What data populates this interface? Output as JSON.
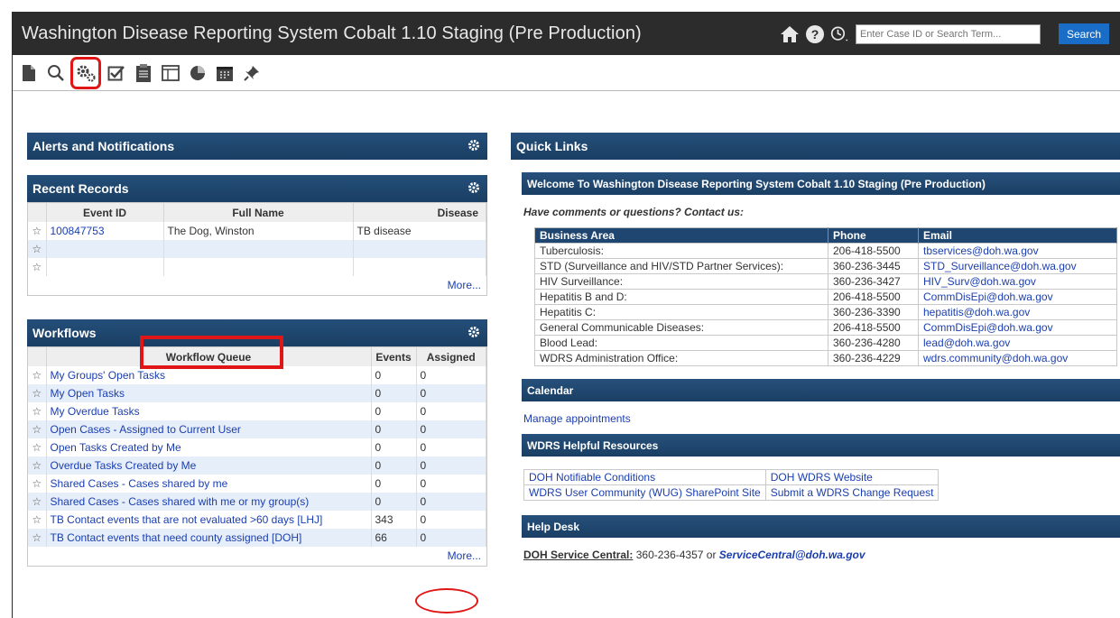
{
  "app": {
    "title": "Washington Disease Reporting System Cobalt 1.10 Staging (Pre Production)"
  },
  "topbar": {
    "search_placeholder": "Enter Case ID or Search Term...",
    "search_button": "Search"
  },
  "alerts": {
    "title": "Alerts and Notifications"
  },
  "recent": {
    "title": "Recent Records",
    "columns": [
      "Event ID",
      "Full Name",
      "Disease"
    ],
    "rows": [
      {
        "id": "100847753",
        "name": "The Dog, Winston",
        "disease": "TB disease"
      }
    ],
    "more": "More..."
  },
  "workflows": {
    "title": "Workflows",
    "columns": [
      "Workflow Queue",
      "Events",
      "Assigned"
    ],
    "rows": [
      {
        "name": "My Groups' Open Tasks",
        "events": "0",
        "assigned": "0"
      },
      {
        "name": "My Open Tasks",
        "events": "0",
        "assigned": "0"
      },
      {
        "name": "My Overdue Tasks",
        "events": "0",
        "assigned": "0"
      },
      {
        "name": "Open Cases - Assigned to Current User",
        "events": "0",
        "assigned": "0"
      },
      {
        "name": "Open Tasks Created by Me",
        "events": "0",
        "assigned": "0"
      },
      {
        "name": "Overdue Tasks Created by Me",
        "events": "0",
        "assigned": "0"
      },
      {
        "name": "Shared Cases - Cases shared by me",
        "events": "0",
        "assigned": "0"
      },
      {
        "name": "Shared Cases - Cases shared with me or my group(s)",
        "events": "0",
        "assigned": "0"
      },
      {
        "name": "TB Contact events that are not evaluated >60 days [LHJ]",
        "events": "343",
        "assigned": "0"
      },
      {
        "name": "TB Contact events that need county assigned [DOH]",
        "events": "66",
        "assigned": "0"
      }
    ],
    "more": "More..."
  },
  "quicklinks": {
    "title": "Quick Links",
    "welcome": "Welcome To Washington Disease Reporting System Cobalt 1.10 Staging (Pre Production)",
    "contact_prompt": "Have comments or questions? Contact us:",
    "contact_columns": [
      "Business Area",
      "Phone",
      "Email"
    ],
    "contacts": [
      {
        "area": "Tuberculosis:",
        "phone": "206-418-5500",
        "email": "tbservices@doh.wa.gov"
      },
      {
        "area": "STD (Surveillance and HIV/STD Partner Services):",
        "phone": "360-236-3445",
        "email": "STD_Surveillance@doh.wa.gov"
      },
      {
        "area": "HIV Surveillance:",
        "phone": "360-236-3427",
        "email": "HIV_Surv@doh.wa.gov"
      },
      {
        "area": "Hepatitis B and D:",
        "phone": "206-418-5500",
        "email": "CommDisEpi@doh.wa.gov"
      },
      {
        "area": "Hepatitis C:",
        "phone": "360-236-3390",
        "email": "hepatitis@doh.wa.gov"
      },
      {
        "area": "General Communicable Diseases:",
        "phone": "206-418-5500",
        "email": "CommDisEpi@doh.wa.gov"
      },
      {
        "area": "Blood Lead:",
        "phone": "360-236-4280",
        "email": "lead@doh.wa.gov"
      },
      {
        "area": "WDRS Administration Office:",
        "phone": "360-236-4229",
        "email": "wdrs.community@doh.wa.gov"
      }
    ],
    "calendar_title": "Calendar",
    "calendar_link": "Manage appointments",
    "resources_title": "WDRS Helpful Resources",
    "resources": [
      [
        "DOH Notifiable Conditions",
        "DOH WDRS Website"
      ],
      [
        "WDRS User Community (WUG) SharePoint Site",
        "Submit a WDRS Change Request"
      ]
    ],
    "helpdesk_title": "Help Desk",
    "helpdesk_label": "DOH Service Central:",
    "helpdesk_phone": " 360-236-4357 or ",
    "helpdesk_email": "ServiceCentral@doh.wa.gov"
  },
  "colors": {
    "header_bar": "#2c2c2c",
    "panel_header": "#1f4670",
    "link": "#1a3eb0",
    "annotation": "#e01515",
    "alt_row": "#e6eef9"
  }
}
